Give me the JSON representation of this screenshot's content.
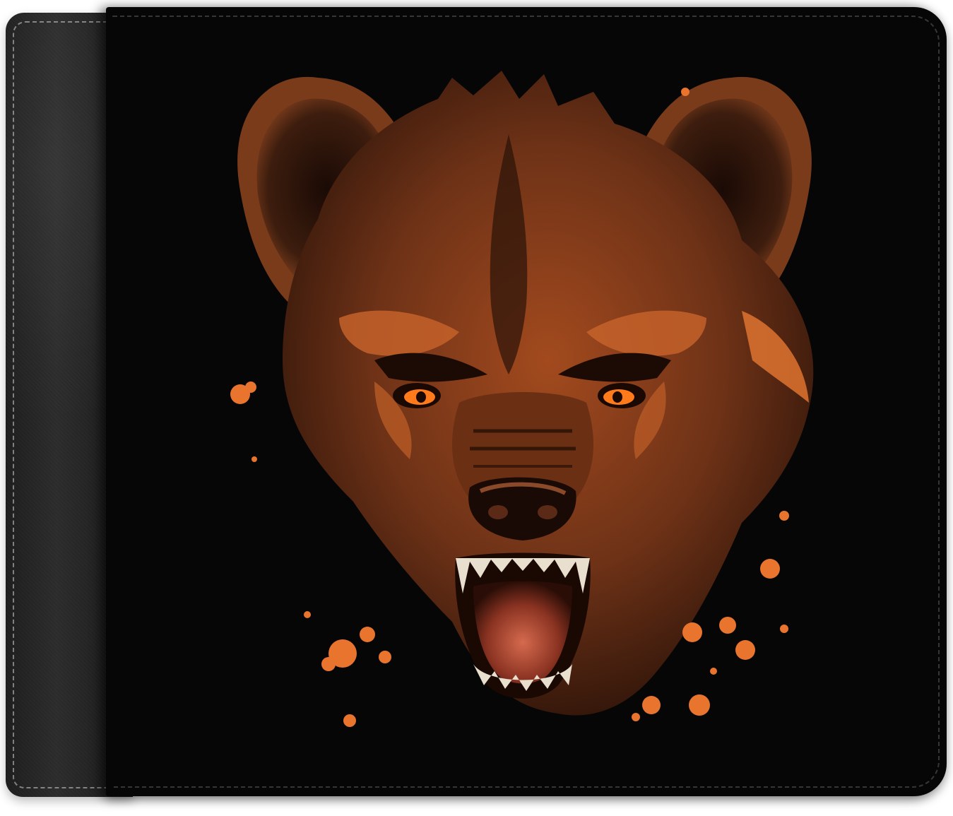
{
  "product": {
    "type": "bifold-wallet",
    "leather_color": "#1a1a1a",
    "print_background": "#060606"
  },
  "artwork": {
    "subject": "snarling-hyena-head",
    "palette": {
      "fur_dark": "#3a1a0c",
      "fur_mid": "#7a3b1a",
      "fur_light": "#c4622a",
      "accent_orange": "#e8742e",
      "eye_orange": "#ff7a1a",
      "mouth": "#c8604a",
      "teeth": "#e9dfcf"
    }
  }
}
